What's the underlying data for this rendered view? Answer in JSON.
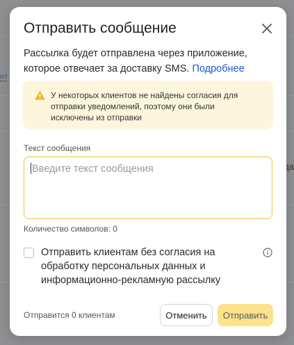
{
  "background": {
    "link_fragment": "нт",
    "side_fragment": "да"
  },
  "modal": {
    "title": "Отправить сообщение",
    "description": "Рассылка будет отправлена через приложение, которое отвечает за доставку SMS.",
    "description_link": "Подробнее",
    "warning": {
      "icon": "warning-triangle-icon",
      "text": "У некоторых клиентов не найдены согласия для отправки уведомлений, поэтому они были исключены из отправки"
    },
    "message_field": {
      "label": "Текст сообщения",
      "placeholder": "Введите текст сообщения",
      "value": ""
    },
    "char_counter": "Количество символов: 0",
    "consent_checkbox": {
      "label": "Отправить клиентам без согласия на обработку персональных данных и информационно-рекламную рассылку",
      "checked": false
    },
    "footer": {
      "recipients": "Отправится 0 клиентам",
      "cancel_label": "Отменить",
      "send_label": "Отправить"
    }
  },
  "colors": {
    "accent_yellow": "#fbe28b",
    "warning_bg": "#fdf6dc",
    "link_blue": "#1f56c9",
    "field_border": "#f0c33c"
  }
}
